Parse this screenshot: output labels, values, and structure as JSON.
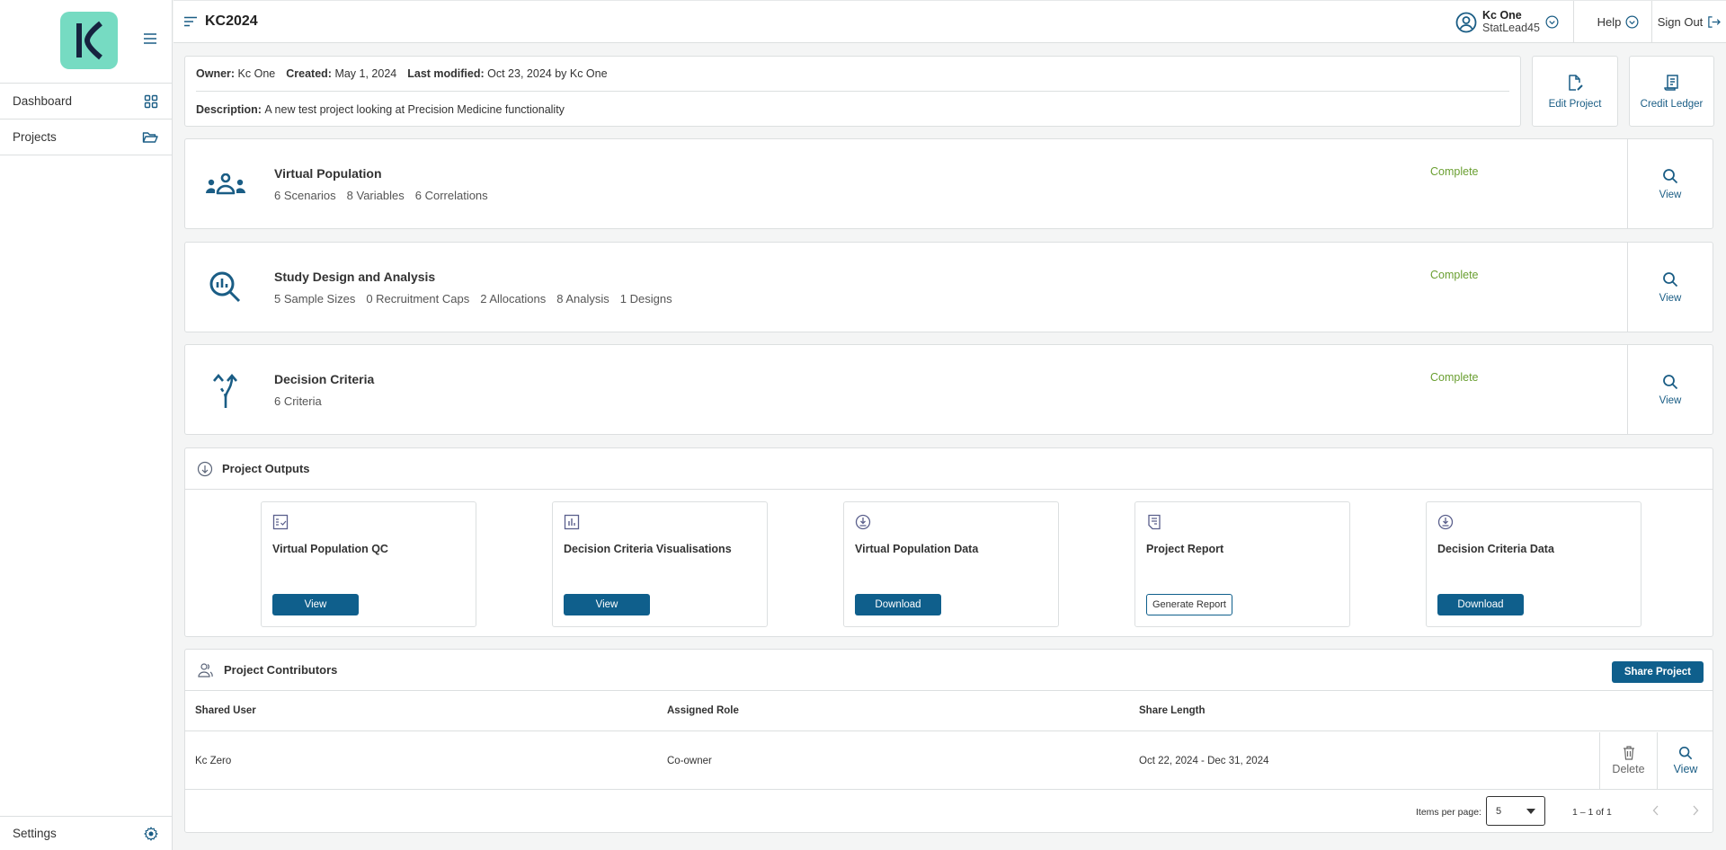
{
  "sidebar": {
    "logo_letter": "K",
    "items": [
      {
        "label": "Dashboard",
        "icon": "grid-icon"
      },
      {
        "label": "Projects",
        "icon": "folder-open-icon"
      }
    ],
    "settings_label": "Settings"
  },
  "header": {
    "title": "KC2024",
    "user": {
      "name": "Kc One",
      "handle": "StatLead45"
    },
    "help_label": "Help",
    "signout_label": "Sign Out"
  },
  "project_info": {
    "owner_label": "Owner:",
    "owner": "Kc One",
    "created_label": "Created:",
    "created": "May 1, 2024",
    "modified_label": "Last modified:",
    "modified": "Oct 23, 2024 by Kc One",
    "description_label": "Description:",
    "description": "A new test project looking at Precision Medicine functionality"
  },
  "actions": {
    "edit_label": "Edit Project",
    "ledger_label": "Credit Ledger"
  },
  "sections": [
    {
      "title": "Virtual Population",
      "stats": [
        "6 Scenarios",
        "8 Variables",
        "6 Correlations"
      ],
      "status": "Complete",
      "view_label": "View"
    },
    {
      "title": "Study Design and Analysis",
      "stats": [
        "5 Sample Sizes",
        "0 Recruitment Caps",
        "2 Allocations",
        "8 Analysis",
        "1 Designs"
      ],
      "status": "Complete",
      "view_label": "View"
    },
    {
      "title": "Decision Criteria",
      "stats": [
        "6 Criteria"
      ],
      "status": "Complete",
      "view_label": "View"
    }
  ],
  "outputs": {
    "title": "Project Outputs",
    "cards": [
      {
        "title": "Virtual Population QC",
        "button": "View",
        "icon": "checklist-icon"
      },
      {
        "title": "Decision Criteria Visualisations",
        "button": "View",
        "icon": "bar-chart-icon"
      },
      {
        "title": "Virtual Population Data",
        "button": "Download",
        "icon": "download-circle-icon"
      },
      {
        "title": "Project Report",
        "button": "Generate Report",
        "icon": "report-icon"
      },
      {
        "title": "Decision Criteria Data",
        "button": "Download",
        "icon": "download-circle-icon"
      }
    ]
  },
  "contributors": {
    "title": "Project Contributors",
    "share_label": "Share Project",
    "columns": [
      "Shared User",
      "Assigned Role",
      "Share Length"
    ],
    "rows": [
      {
        "user": "Kc Zero",
        "role": "Co-owner",
        "length": "Oct 22, 2024 - Dec 31, 2024",
        "delete_label": "Delete",
        "view_label": "View"
      }
    ],
    "paginator": {
      "items_per_page_label": "Items per page:",
      "items_per_page": "5",
      "range": "1 – 1 of 1"
    }
  },
  "colors": {
    "primary": "#0f5f8c",
    "logo_bg": "#76dbc2",
    "logo_fg": "#16233f",
    "status_complete": "#6a9f31"
  }
}
